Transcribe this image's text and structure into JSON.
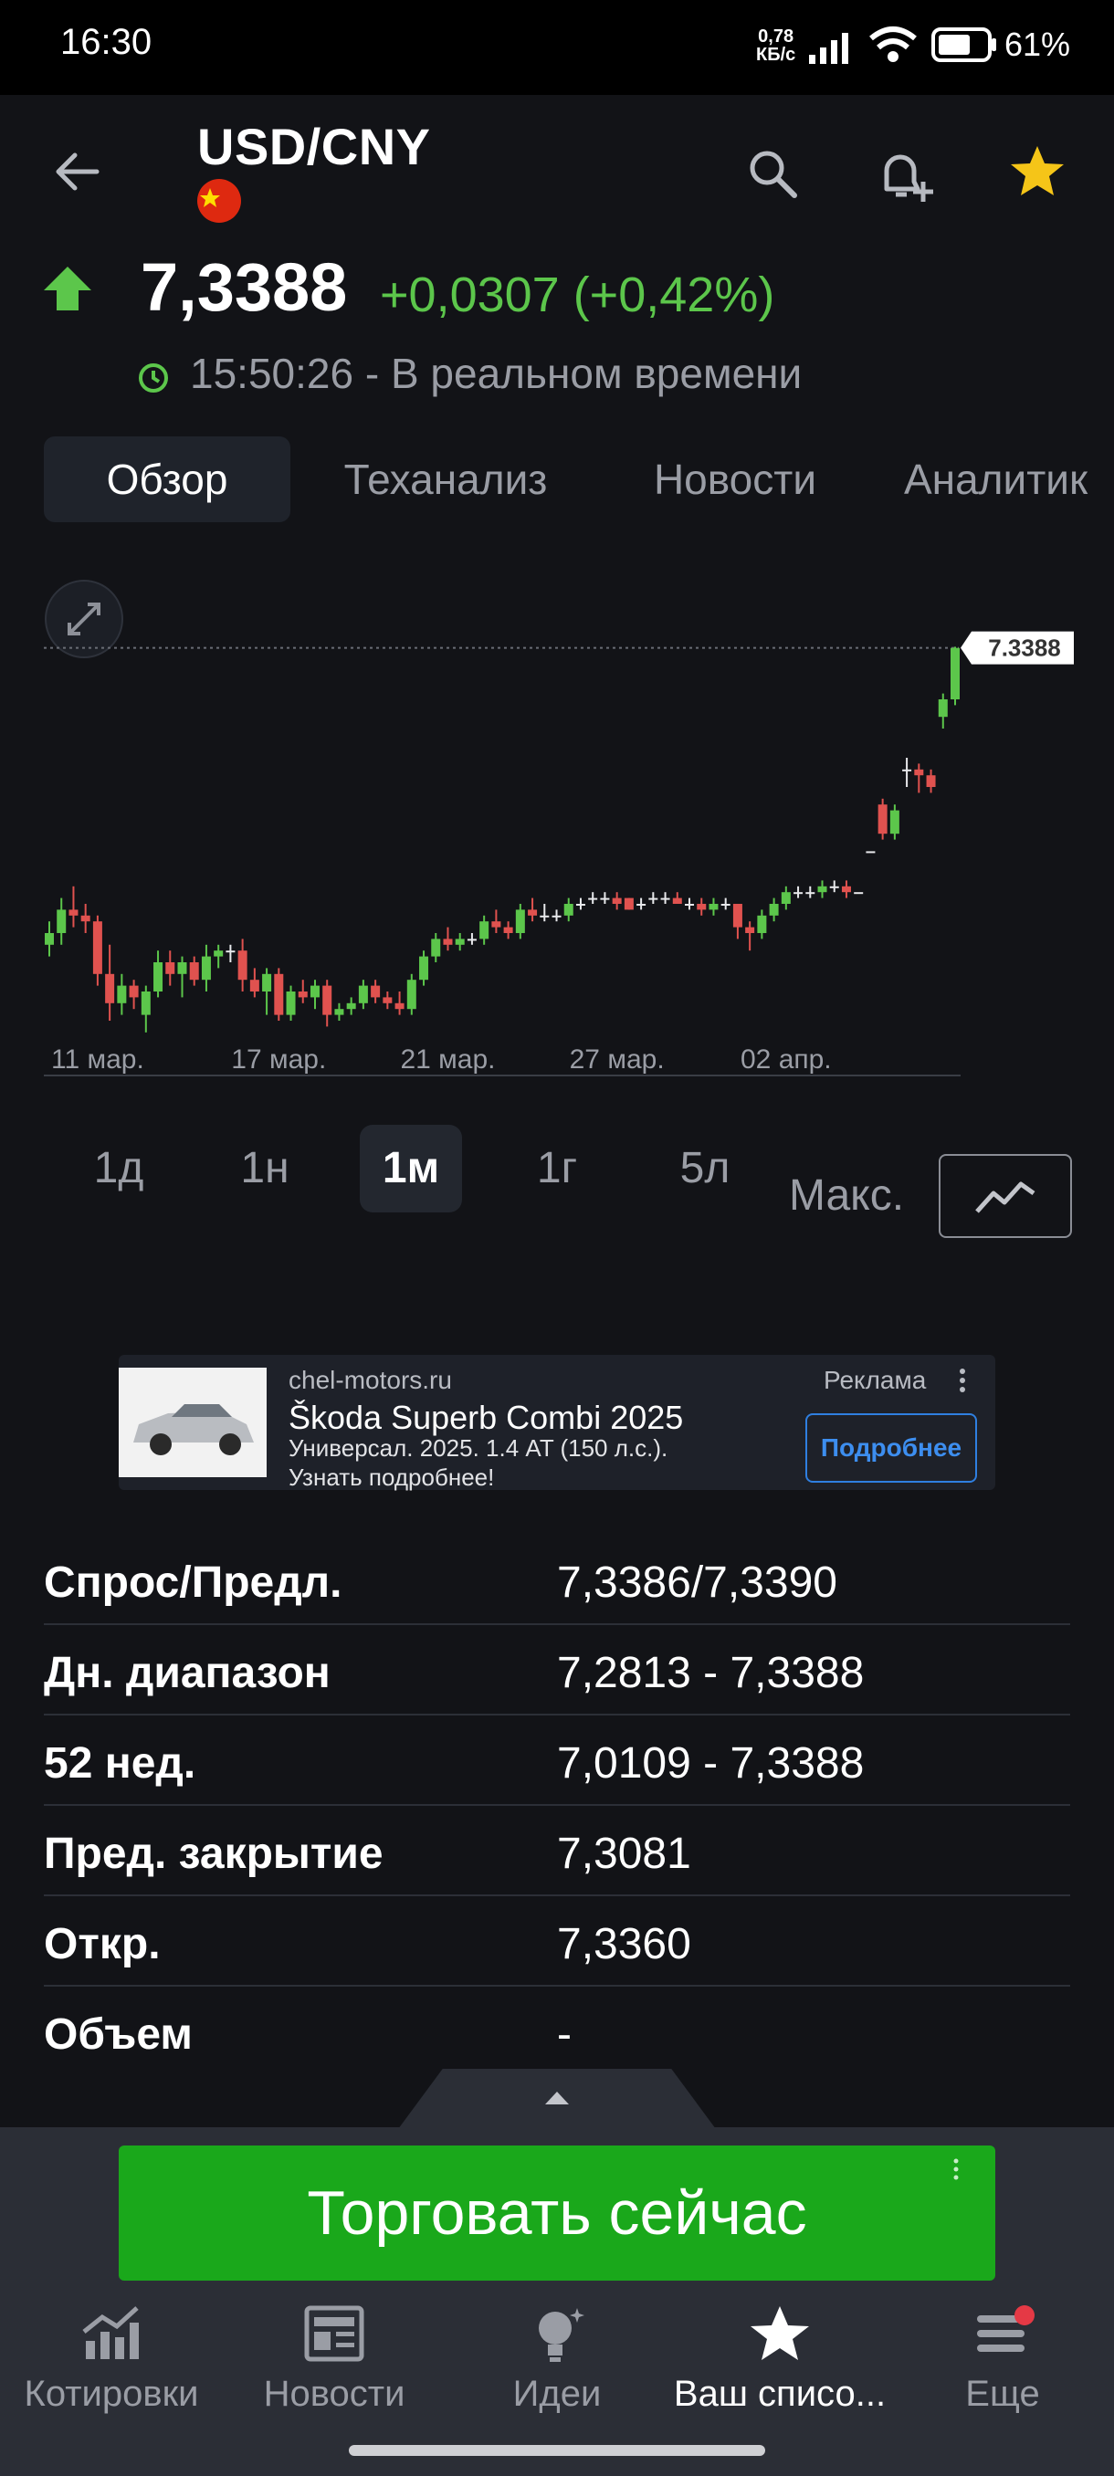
{
  "status_bar": {
    "time": "16:30",
    "network_speed_value": "0,78",
    "network_speed_unit": "КБ/с",
    "battery": "61%"
  },
  "header": {
    "symbol": "USD/CNY",
    "flag_icon": "china-flag-icon",
    "price": "7,3388",
    "change": "+0,0307 (+0,42%)",
    "timestamp": "15:50:26 - В реальном времени",
    "trend_color": "#5cc64b"
  },
  "tabs": [
    {
      "label": "Обзор",
      "active": true
    },
    {
      "label": "Теханализ",
      "active": false
    },
    {
      "label": "Новости",
      "active": false
    },
    {
      "label": "Аналитик",
      "active": false
    }
  ],
  "chart_data": {
    "type": "candlestick",
    "x_tick_labels": [
      "11 мар.",
      "17 мар.",
      "21 мар.",
      "27 мар.",
      "02 апр."
    ],
    "last_price_label": "7.3388",
    "up_color": "#5cc64b",
    "down_color": "#e0524f",
    "ylim": [
      7.27,
      7.345
    ],
    "candles": [
      {
        "o": 7.288,
        "h": 7.292,
        "l": 7.286,
        "c": 7.29
      },
      {
        "o": 7.29,
        "h": 7.296,
        "l": 7.288,
        "c": 7.294
      },
      {
        "o": 7.294,
        "h": 7.298,
        "l": 7.291,
        "c": 7.293
      },
      {
        "o": 7.293,
        "h": 7.295,
        "l": 7.29,
        "c": 7.292
      },
      {
        "o": 7.292,
        "h": 7.293,
        "l": 7.281,
        "c": 7.283
      },
      {
        "o": 7.283,
        "h": 7.288,
        "l": 7.275,
        "c": 7.278
      },
      {
        "o": 7.278,
        "h": 7.283,
        "l": 7.276,
        "c": 7.281
      },
      {
        "o": 7.281,
        "h": 7.282,
        "l": 7.277,
        "c": 7.279
      },
      {
        "o": 7.276,
        "h": 7.281,
        "l": 7.273,
        "c": 7.28
      },
      {
        "o": 7.28,
        "h": 7.287,
        "l": 7.279,
        "c": 7.285
      },
      {
        "o": 7.285,
        "h": 7.287,
        "l": 7.281,
        "c": 7.283
      },
      {
        "o": 7.283,
        "h": 7.286,
        "l": 7.279,
        "c": 7.285
      },
      {
        "o": 7.285,
        "h": 7.286,
        "l": 7.281,
        "c": 7.282
      },
      {
        "o": 7.282,
        "h": 7.288,
        "l": 7.28,
        "c": 7.286
      },
      {
        "o": 7.286,
        "h": 7.288,
        "l": 7.284,
        "c": 7.287
      },
      {
        "o": 7.287,
        "h": 7.288,
        "l": 7.285,
        "c": 7.287
      },
      {
        "o": 7.287,
        "h": 7.289,
        "l": 7.28,
        "c": 7.282
      },
      {
        "o": 7.282,
        "h": 7.284,
        "l": 7.279,
        "c": 7.28
      },
      {
        "o": 7.28,
        "h": 7.284,
        "l": 7.276,
        "c": 7.283
      },
      {
        "o": 7.283,
        "h": 7.284,
        "l": 7.275,
        "c": 7.276
      },
      {
        "o": 7.276,
        "h": 7.281,
        "l": 7.275,
        "c": 7.28
      },
      {
        "o": 7.28,
        "h": 7.282,
        "l": 7.278,
        "c": 7.279
      },
      {
        "o": 7.279,
        "h": 7.282,
        "l": 7.277,
        "c": 7.281
      },
      {
        "o": 7.281,
        "h": 7.282,
        "l": 7.274,
        "c": 7.276
      },
      {
        "o": 7.276,
        "h": 7.278,
        "l": 7.275,
        "c": 7.277
      },
      {
        "o": 7.277,
        "h": 7.279,
        "l": 7.276,
        "c": 7.278
      },
      {
        "o": 7.278,
        "h": 7.282,
        "l": 7.277,
        "c": 7.281
      },
      {
        "o": 7.281,
        "h": 7.282,
        "l": 7.278,
        "c": 7.279
      },
      {
        "o": 7.279,
        "h": 7.28,
        "l": 7.277,
        "c": 7.278
      },
      {
        "o": 7.278,
        "h": 7.28,
        "l": 7.276,
        "c": 7.277
      },
      {
        "o": 7.277,
        "h": 7.283,
        "l": 7.276,
        "c": 7.282
      },
      {
        "o": 7.282,
        "h": 7.287,
        "l": 7.281,
        "c": 7.286
      },
      {
        "o": 7.286,
        "h": 7.29,
        "l": 7.285,
        "c": 7.289
      },
      {
        "o": 7.289,
        "h": 7.291,
        "l": 7.287,
        "c": 7.288
      },
      {
        "o": 7.288,
        "h": 7.29,
        "l": 7.287,
        "c": 7.289
      },
      {
        "o": 7.289,
        "h": 7.29,
        "l": 7.288,
        "c": 7.289
      },
      {
        "o": 7.289,
        "h": 7.293,
        "l": 7.288,
        "c": 7.292
      },
      {
        "o": 7.292,
        "h": 7.294,
        "l": 7.29,
        "c": 7.291
      },
      {
        "o": 7.291,
        "h": 7.292,
        "l": 7.289,
        "c": 7.29
      },
      {
        "o": 7.29,
        "h": 7.295,
        "l": 7.289,
        "c": 7.294
      },
      {
        "o": 7.294,
        "h": 7.296,
        "l": 7.292,
        "c": 7.293
      },
      {
        "o": 7.293,
        "h": 7.295,
        "l": 7.292,
        "c": 7.293
      },
      {
        "o": 7.293,
        "h": 7.294,
        "l": 7.292,
        "c": 7.293
      },
      {
        "o": 7.293,
        "h": 7.296,
        "l": 7.292,
        "c": 7.295
      },
      {
        "o": 7.295,
        "h": 7.296,
        "l": 7.294,
        "c": 7.295
      },
      {
        "o": 7.296,
        "h": 7.297,
        "l": 7.295,
        "c": 7.296
      },
      {
        "o": 7.296,
        "h": 7.297,
        "l": 7.295,
        "c": 7.296
      },
      {
        "o": 7.296,
        "h": 7.297,
        "l": 7.294,
        "c": 7.295
      },
      {
        "o": 7.296,
        "h": 7.296,
        "l": 7.294,
        "c": 7.294
      },
      {
        "o": 7.295,
        "h": 7.296,
        "l": 7.294,
        "c": 7.295
      },
      {
        "o": 7.296,
        "h": 7.297,
        "l": 7.295,
        "c": 7.296
      },
      {
        "o": 7.296,
        "h": 7.297,
        "l": 7.295,
        "c": 7.296
      },
      {
        "o": 7.296,
        "h": 7.297,
        "l": 7.295,
        "c": 7.295
      },
      {
        "o": 7.295,
        "h": 7.296,
        "l": 7.294,
        "c": 7.295
      },
      {
        "o": 7.295,
        "h": 7.296,
        "l": 7.293,
        "c": 7.294
      },
      {
        "o": 7.294,
        "h": 7.296,
        "l": 7.293,
        "c": 7.295
      },
      {
        "o": 7.295,
        "h": 7.296,
        "l": 7.294,
        "c": 7.295
      },
      {
        "o": 7.295,
        "h": 7.295,
        "l": 7.289,
        "c": 7.291
      },
      {
        "o": 7.291,
        "h": 7.292,
        "l": 7.287,
        "c": 7.29
      },
      {
        "o": 7.29,
        "h": 7.294,
        "l": 7.289,
        "c": 7.293
      },
      {
        "o": 7.293,
        "h": 7.296,
        "l": 7.292,
        "c": 7.295
      },
      {
        "o": 7.295,
        "h": 7.298,
        "l": 7.294,
        "c": 7.297
      },
      {
        "o": 7.297,
        "h": 7.298,
        "l": 7.296,
        "c": 7.297
      },
      {
        "o": 7.297,
        "h": 7.298,
        "l": 7.296,
        "c": 7.297
      },
      {
        "o": 7.297,
        "h": 7.299,
        "l": 7.296,
        "c": 7.298
      },
      {
        "o": 7.298,
        "h": 7.299,
        "l": 7.297,
        "c": 7.298
      },
      {
        "o": 7.298,
        "h": 7.299,
        "l": 7.296,
        "c": 7.297
      },
      {
        "o": 7.297,
        "h": 7.297,
        "l": 7.297,
        "c": 7.297
      },
      {
        "o": 7.304,
        "h": 7.304,
        "l": 7.304,
        "c": 7.304
      },
      {
        "o": 7.312,
        "h": 7.313,
        "l": 7.306,
        "c": 7.307
      },
      {
        "o": 7.307,
        "h": 7.312,
        "l": 7.306,
        "c": 7.311
      },
      {
        "o": 7.318,
        "h": 7.32,
        "l": 7.315,
        "c": 7.318
      },
      {
        "o": 7.318,
        "h": 7.319,
        "l": 7.314,
        "c": 7.317
      },
      {
        "o": 7.317,
        "h": 7.318,
        "l": 7.314,
        "c": 7.315
      },
      {
        "o": 7.327,
        "h": 7.331,
        "l": 7.325,
        "c": 7.33
      },
      {
        "o": 7.33,
        "h": 7.339,
        "l": 7.329,
        "c": 7.3388
      }
    ]
  },
  "ranges": [
    {
      "label": "1д",
      "active": false
    },
    {
      "label": "1н",
      "active": false
    },
    {
      "label": "1м",
      "active": true
    },
    {
      "label": "1г",
      "active": false
    },
    {
      "label": "5л",
      "active": false
    },
    {
      "label": "Макс.",
      "active": false
    }
  ],
  "ad": {
    "site": "chel-motors.ru",
    "label": "Реклама",
    "title": "Škoda Superb Combi 2025",
    "description": "Универсал. 2025. 1.4 AT (150 л.с.). Узнать подробнее!",
    "button": "Подробнее"
  },
  "stats": [
    {
      "label": "Спрос/Предл.",
      "value": "7,3386/7,3390"
    },
    {
      "label": "Дн. диапазон",
      "value": "7,2813 - 7,3388"
    },
    {
      "label": "52 нед.",
      "value": "7,0109 - 7,3388"
    },
    {
      "label": "Пред. закрытие",
      "value": "7,3081"
    },
    {
      "label": "Откр.",
      "value": "7,3360"
    },
    {
      "label": "Объем",
      "value": "-"
    }
  ],
  "trade_button": "Торговать сейчас",
  "bottom_nav": [
    {
      "label": "Котировки",
      "icon": "quotes-chart-icon",
      "active": false
    },
    {
      "label": "Новости",
      "icon": "news-icon",
      "active": false
    },
    {
      "label": "Идеи",
      "icon": "ideas-bulb-icon",
      "active": false
    },
    {
      "label": "Ваш списо...",
      "icon": "watchlist-star-icon",
      "active": true
    },
    {
      "label": "Еще",
      "icon": "menu-icon",
      "active": false
    }
  ],
  "colors": {
    "accent_green": "#1aa81b",
    "star": "#f5c518",
    "notification_dot": "#e53945"
  }
}
